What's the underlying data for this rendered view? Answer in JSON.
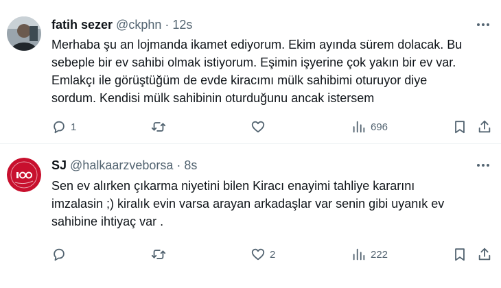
{
  "colors": {
    "secondary_text": "#536471",
    "primary_text": "#0f1419",
    "divider": "#eff3f4"
  },
  "tweets": [
    {
      "display_name": "fatih sezer",
      "handle": "@ckphn",
      "separator": "·",
      "time": "12s",
      "body_lines": [
        "Merhaba şu an lojmanda ikamet ediyorum. Ekim ayında sürem dolacak. Bu",
        "sebeple bir ev sahibi olmak istiyorum. Eşimin işyerine çok yakın bir ev var.",
        "Emlakçı ile görüştüğüm de evde kiracımı mülk sahibimi oturuyor diye",
        "sordum. Kendisi mülk sahibinin oturduğunu ancak istersem"
      ],
      "replies": "1",
      "retweets": "",
      "likes": "",
      "views": "696"
    },
    {
      "display_name": "SJ",
      "handle": "@halkaarzveborsa",
      "separator": "·",
      "time": "8s",
      "body_lines": [
        "Sen ev alırken çıkarma niyetini bilen Kiracı enayimi tahliye kararını",
        "imzalasin ;) kiralık evin varsa arayan arkadaşlar var senin gibi uyanık ev",
        "sahibine ihtiyaç var ."
      ],
      "replies": "",
      "retweets": "",
      "likes": "2",
      "views": "222"
    }
  ],
  "icons": {
    "reply": "reply-icon",
    "retweet": "retweet-icon",
    "like": "heart-icon",
    "views": "views-chart-icon",
    "bookmark": "bookmark-icon",
    "share": "share-icon",
    "more": "more-options-icon"
  }
}
